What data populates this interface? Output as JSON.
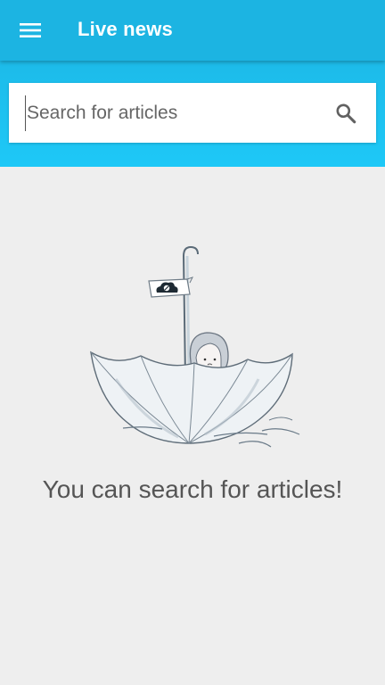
{
  "app_bar": {
    "title": "Live news",
    "menu_icon": "hamburger-menu-icon"
  },
  "search": {
    "placeholder": "Search for articles",
    "value": "",
    "icon": "search-icon"
  },
  "empty_state": {
    "message": "You can search for articles!",
    "illustration": "girl-in-umbrella-boat-illustration"
  },
  "colors": {
    "app_bar": "#1cb4e2",
    "search_band": "#1ec8f7",
    "background": "#eeeeee"
  }
}
